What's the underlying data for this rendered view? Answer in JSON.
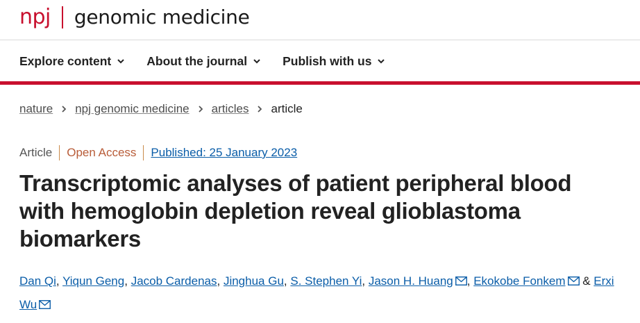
{
  "brand": {
    "prefix": "npj",
    "journal": "genomic medicine",
    "accent": "#c8102e"
  },
  "nav": {
    "items": [
      {
        "label": "Explore content"
      },
      {
        "label": "About the journal"
      },
      {
        "label": "Publish with us"
      }
    ]
  },
  "breadcrumb": {
    "items": [
      "nature",
      "npj genomic medicine",
      "articles"
    ],
    "current": "article"
  },
  "meta": {
    "type": "Article",
    "access": "Open Access",
    "published": "Published: 25 January 2023"
  },
  "article": {
    "title": "Transcriptomic analyses of patient peripheral blood with hemoglobin depletion reveal glioblastoma biomarkers"
  },
  "authors": {
    "list": [
      "Dan Qi",
      "Yiqun Geng",
      "Jacob Cardenas",
      "Jinghua Gu",
      "S. Stephen Yi",
      "Jason H. Huang",
      "Ekokobe Fonkem",
      "Erxi Wu"
    ],
    "separator": ",",
    "conjunction": "&"
  }
}
